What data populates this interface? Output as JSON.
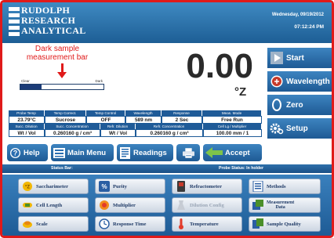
{
  "header": {
    "logo_lines": [
      "RUDOLPH",
      "RESEARCH",
      "ANALYTICAL"
    ],
    "date": "Wednesday, 09/19/2012",
    "time": "07:12:24 PM"
  },
  "annotation": {
    "text_line1": "Dark sample",
    "text_line2": "measurement bar"
  },
  "sample_bar": {
    "left_label": "Clear",
    "right_label": "Dark",
    "level_fraction": 0.25
  },
  "reading": {
    "value": "0.00",
    "unit": "°Z"
  },
  "info_table": {
    "row1_headers": [
      "Probe Temp",
      "Temp Correct.",
      "Temp Control",
      "Wavelength",
      "Response",
      "Meas. Mode"
    ],
    "row1_values": [
      "23.79°C",
      "Sucrose",
      "OFF",
      "589 nm",
      "2 Sec",
      "Free Run"
    ],
    "row2_headers": [
      "Succ. Dilution",
      "Succ. Concentration",
      "Refr. Dilution",
      "Refr. Concentration",
      "Cell Lg / Multiplier"
    ],
    "row2_values": [
      "Wt / Vol",
      "0.260160 g / cm³",
      "Wt / Vol",
      "0.260160 g / cm³",
      "100.00 mm / 1"
    ]
  },
  "toolbar": {
    "help": "Help",
    "main_menu": "Main Menu",
    "readings": "Readings",
    "accept": "Accept"
  },
  "side_buttons": {
    "start": "Start",
    "wavelength": "Wavelength",
    "zero": "Zero",
    "setup": "Setup"
  },
  "status": {
    "label": "Status Bar:",
    "message": "Probe Status: In holder"
  },
  "grid": {
    "saccharimeter": "Saccharimeter",
    "purity": "Purity",
    "refractometer": "Refractometer",
    "methods": "Methods",
    "cell_length": "Cell Length",
    "multiplier": "Multiplier",
    "dilution_config": "Dilution Config",
    "measurement_data_1": "Measurement",
    "measurement_data_2": "Data",
    "scale": "Scale",
    "response_time": "Response Time",
    "temperature": "Temperature",
    "sample_quality": "Sample Quality"
  },
  "colors": {
    "frame_border": "#e01a1a",
    "header_blue": "#1d5e95",
    "annotation_red": "#e01a1a",
    "accept_arrow": "#7ec34a"
  }
}
